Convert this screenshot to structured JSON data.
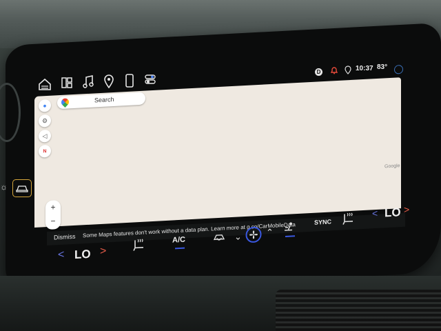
{
  "status": {
    "drive_icon": "D",
    "time": "10:37",
    "temperature": "83°"
  },
  "icons": {
    "home": "home-icon",
    "grid": "grid-icon",
    "music": "music-icon",
    "nav": "location-pin-icon",
    "phone": "phone-icon",
    "apps": "toggles-icon"
  },
  "map": {
    "search_placeholder": "Search",
    "zoom_in": "+",
    "zoom_out": "−",
    "compass_label": "N",
    "attribution": "Google"
  },
  "banner": {
    "dismiss_label": "Dismiss",
    "message": "Some Maps features don't work without a data plan. Learn more at g.co/CarMobileData"
  },
  "climate": {
    "left_temp": "LO",
    "right_temp": "LO",
    "ac_label": "A/C",
    "sync_label": "SYNC"
  },
  "colors": {
    "accent_blue": "#3a58e0",
    "alert_red": "#e84a3a",
    "left_chevron": "#6a77e6",
    "right_chevron": "#e85d4a",
    "map_bg": "#efe9e1"
  }
}
